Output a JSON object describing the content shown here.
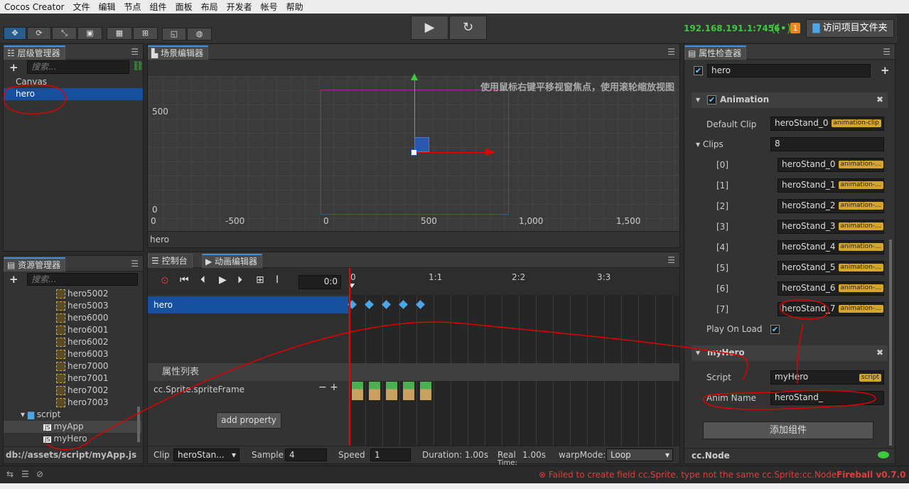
{
  "menubar": {
    "items": [
      "Cocos Creator",
      "文件",
      "编辑",
      "节点",
      "组件",
      "面板",
      "布局",
      "开发者",
      "帐号",
      "帮助"
    ]
  },
  "toolbar": {
    "ip": "192.168.191.1:7456",
    "badge": "1",
    "open_project_label": "访问项目文件夹"
  },
  "hierarchy": {
    "tab": "层级管理器",
    "search_placeholder": "搜索...",
    "nodes": [
      "Canvas",
      "hero"
    ]
  },
  "scene": {
    "tab": "场景编辑器",
    "hint": "使用鼠标右键平移视窗焦点，使用滚轮缩放视图",
    "ylabels": [
      "500",
      "0"
    ],
    "xlabels": [
      "-500",
      "0",
      "500",
      "1,000",
      "1,500"
    ],
    "footer": "hero"
  },
  "assets": {
    "tab": "资源管理器",
    "search_placeholder": "搜索...",
    "items": [
      "hero5002",
      "hero5003",
      "hero6000",
      "hero6001",
      "hero6002",
      "hero6003",
      "hero7000",
      "hero7001",
      "hero7002",
      "hero7003"
    ],
    "folder": "script",
    "scripts": [
      "myApp",
      "myHero"
    ],
    "path": "db://assets/script/myApp.js"
  },
  "animation": {
    "tab_console": "控制台",
    "tab_anim": "动画编辑器",
    "time": "0:0",
    "ruler": [
      "0",
      "1:1",
      "2:2",
      "3:3"
    ],
    "node": "hero",
    "prop_header": "属性列表",
    "prop": "cc.Sprite.spriteFrame",
    "add_property": "add property",
    "footer": {
      "clip_label": "Clip",
      "clip_value": "heroStan...",
      "sample_label": "Sample",
      "sample_value": "4",
      "speed_label": "Speed",
      "speed_value": "1",
      "duration": "Duration: 1.00s",
      "real_label": "Real",
      "real_value": "1.00s",
      "time_label": "Time:",
      "warp_label": "warpMode:",
      "warp_value": "Loop"
    }
  },
  "inspector": {
    "tab": "属性检查器",
    "node_name": "hero",
    "animation_title": "Animation",
    "default_clip_label": "Default Clip",
    "default_clip_value": "heroStand_0",
    "clip_tag": "animation-clip",
    "clips_label": "Clips",
    "clips_count": "8",
    "clip_items": [
      {
        "index": "[0]",
        "value": "heroStand_0"
      },
      {
        "index": "[1]",
        "value": "heroStand_1"
      },
      {
        "index": "[2]",
        "value": "heroStand_2"
      },
      {
        "index": "[3]",
        "value": "heroStand_3"
      },
      {
        "index": "[4]",
        "value": "heroStand_4"
      },
      {
        "index": "[5]",
        "value": "heroStand_5"
      },
      {
        "index": "[6]",
        "value": "heroStand_6"
      },
      {
        "index": "[7]",
        "value": "heroStand_7"
      }
    ],
    "clip_item_tag": "animation-...",
    "play_on_load": "Play On Load",
    "myhero_title": "myHero",
    "script_label": "Script",
    "script_value": "myHero",
    "script_tag": "script",
    "anim_name_label": "Anim Name",
    "anim_name_value": "heroStand_",
    "add_component": "添加组件",
    "footer": "cc.Node"
  },
  "statusbar": {
    "error": "Failed to create field cc.Sprite. type not the same cc.Sprite:cc.Node",
    "version": "Fireball v0.7.0"
  },
  "colors": {
    "accent": "#17509e",
    "annotation": "#e00000",
    "ok": "#3dc93d",
    "error": "#e03c3c"
  }
}
